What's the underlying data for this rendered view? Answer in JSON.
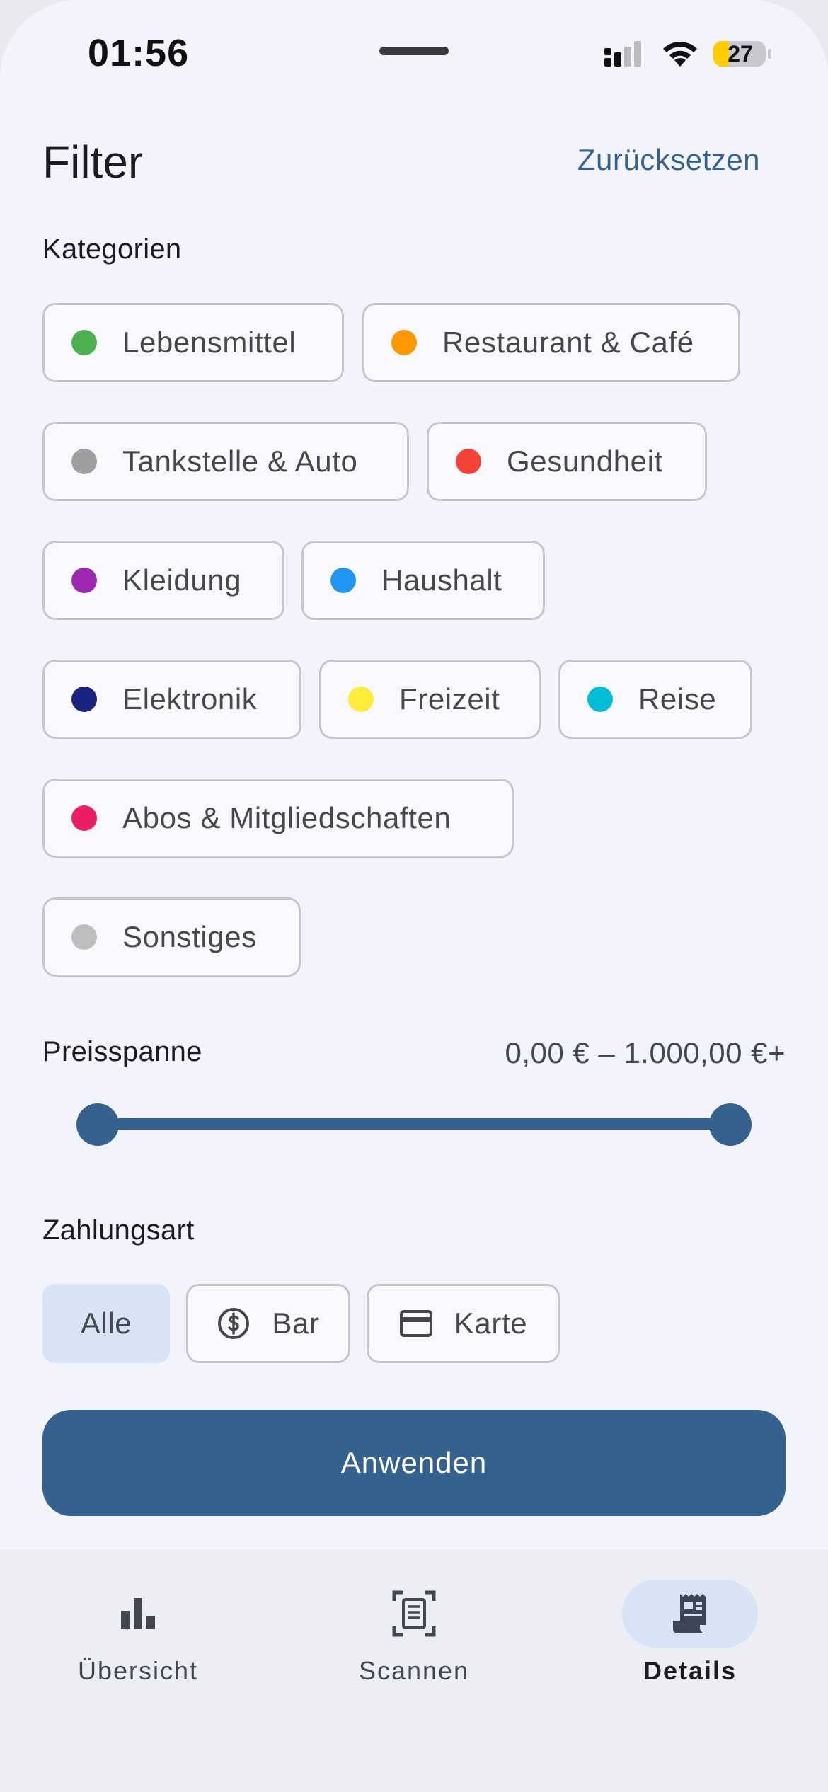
{
  "status_bar": {
    "time": "01:56",
    "battery": "27",
    "icons": [
      "signal-icon",
      "wifi-icon",
      "battery-icon"
    ]
  },
  "header": {
    "title": "Filter",
    "reset_label": "Zurücksetzen"
  },
  "categories": {
    "label": "Kategorien",
    "items": [
      {
        "label": "Lebensmittel",
        "color": "#4caf50"
      },
      {
        "label": "Restaurant & Café",
        "color": "#ff9800"
      },
      {
        "label": "Tankstelle & Auto",
        "color": "#9e9e9e"
      },
      {
        "label": "Gesundheit",
        "color": "#f44336"
      },
      {
        "label": "Kleidung",
        "color": "#9c27b0"
      },
      {
        "label": "Haushalt",
        "color": "#2196f3"
      },
      {
        "label": "Elektronik",
        "color": "#1a237e"
      },
      {
        "label": "Freizeit",
        "color": "#ffeb3b"
      },
      {
        "label": "Reise",
        "color": "#00bcd4"
      },
      {
        "label": "Abos & Mitgliedschaften",
        "color": "#e91e63"
      },
      {
        "label": "Sonstiges",
        "color": "#bdbdbd"
      }
    ]
  },
  "price": {
    "label": "Preisspanne",
    "range_text": "0,00 € – 1.000,00 €+",
    "min_fraction": 0,
    "max_fraction": 1
  },
  "payment": {
    "label": "Zahlungsart",
    "options": [
      {
        "label": "Alle",
        "selected": true,
        "icon": ""
      },
      {
        "label": "Bar",
        "selected": false,
        "icon": "cash-icon"
      },
      {
        "label": "Karte",
        "selected": false,
        "icon": "card-icon"
      }
    ]
  },
  "apply_label": "Anwenden",
  "nav": {
    "items": [
      {
        "label": "Übersicht",
        "icon": "bar-chart-icon",
        "active": false
      },
      {
        "label": "Scannen",
        "icon": "scan-document-icon",
        "active": false
      },
      {
        "label": "Details",
        "icon": "receipt-icon",
        "active": true
      }
    ]
  },
  "colors": {
    "primary": "#35618e",
    "selected_container": "#d8e3f6",
    "background": "#f3f4fb"
  }
}
